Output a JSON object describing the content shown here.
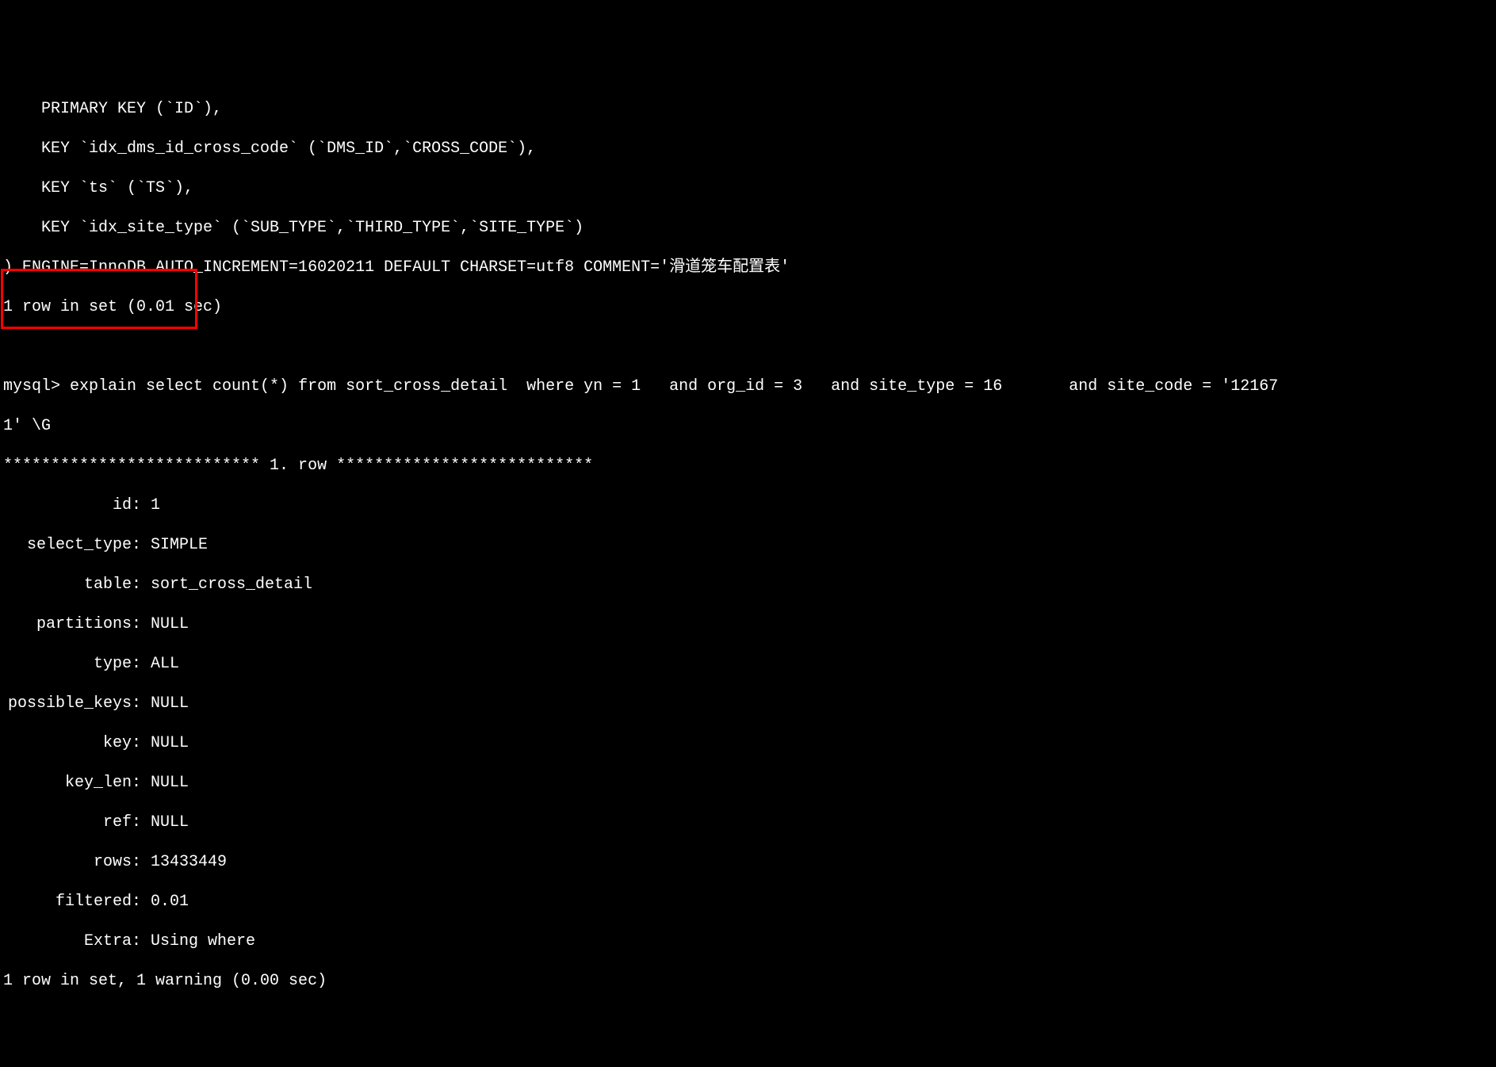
{
  "schema": {
    "line1": "  PRIMARY KEY (`ID`),",
    "line2": "  KEY `idx_dms_id_cross_code` (`DMS_ID`,`CROSS_CODE`),",
    "line3": "  KEY `ts` (`TS`),",
    "line4": "  KEY `idx_site_type` (`SUB_TYPE`,`THIRD_TYPE`,`SITE_TYPE`)",
    "line5": ") ENGINE=InnoDB AUTO_INCREMENT=16020211 DEFAULT CHARSET=utf8 COMMENT='滑道笼车配置表'",
    "result": "1 row in set (0.01 sec)"
  },
  "prompt": "mysql> ",
  "query": {
    "line1": "explain select count(*) from sort_cross_detail  where yn = 1   and org_id = 3   and site_type = 16       and site_code = '12167",
    "line2": "1' \\G"
  },
  "explain": {
    "separator": "*************************** 1. row ***************************",
    "rows": [
      {
        "label": "id",
        "value": "1"
      },
      {
        "label": "select_type",
        "value": "SIMPLE"
      },
      {
        "label": "table",
        "value": "sort_cross_detail"
      },
      {
        "label": "partitions",
        "value": "NULL"
      },
      {
        "label": "type",
        "value": "ALL"
      },
      {
        "label": "possible_keys",
        "value": "NULL"
      },
      {
        "label": "key",
        "value": "NULL"
      },
      {
        "label": "key_len",
        "value": "NULL"
      },
      {
        "label": "ref",
        "value": "NULL"
      },
      {
        "label": "rows",
        "value": "13433449"
      },
      {
        "label": "filtered",
        "value": "0.01"
      },
      {
        "label": "Extra",
        "value": "Using where"
      }
    ],
    "result": "1 row in set, 1 warning (0.00 sec)"
  }
}
